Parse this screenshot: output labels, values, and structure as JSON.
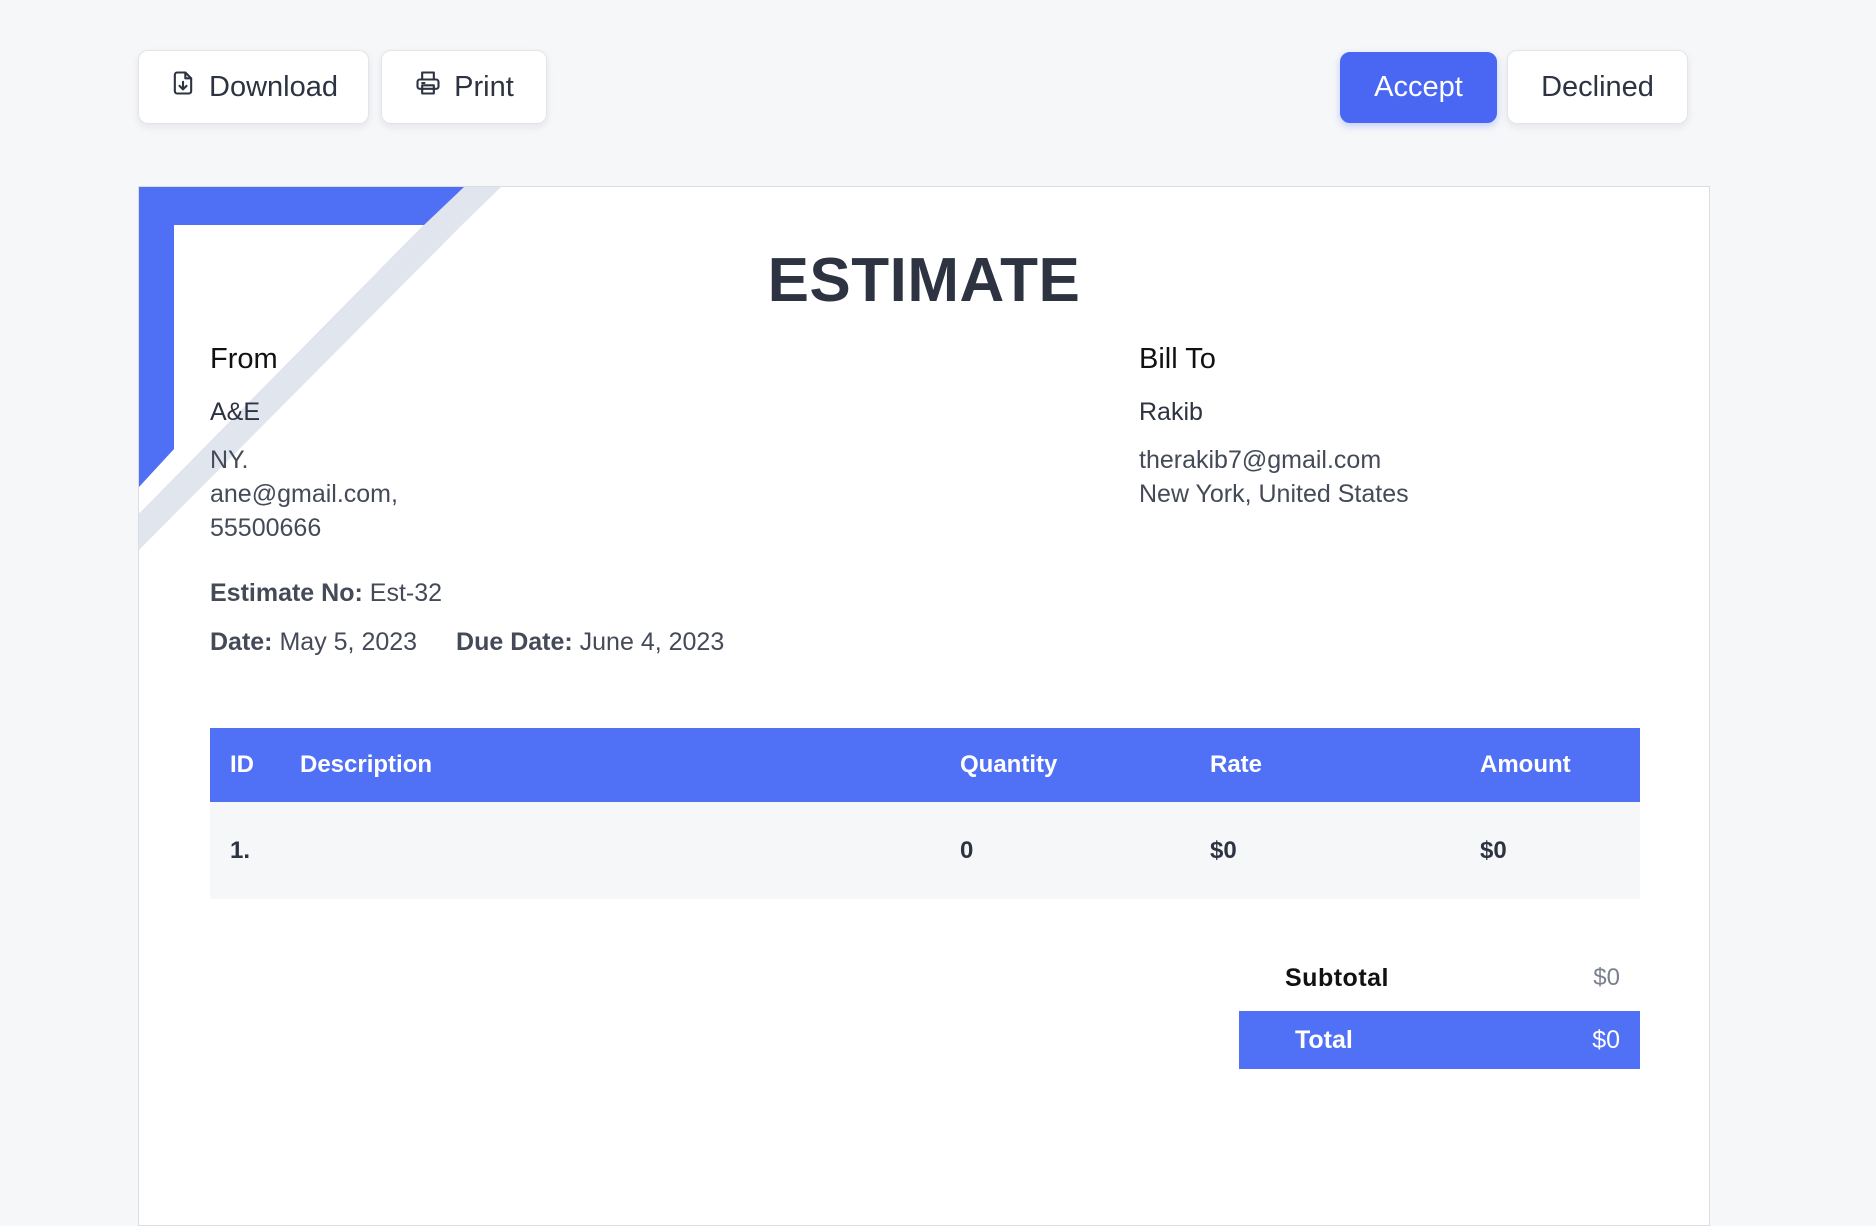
{
  "toolbar": {
    "download_label": "Download",
    "print_label": "Print",
    "accept_label": "Accept",
    "declined_label": "Declined"
  },
  "colors": {
    "accent": "#4a67f3",
    "table_header": "#5070f5",
    "corner_secondary": "#e1e5ee"
  },
  "estimate": {
    "title": "ESTIMATE",
    "from": {
      "heading": "From",
      "name": "A&E",
      "lines": [
        "NY.",
        "ane@gmail.com,",
        "55500666"
      ]
    },
    "bill_to": {
      "heading": "Bill To",
      "name": "Rakib",
      "lines": [
        "therakib7@gmail.com",
        "New York, United States"
      ]
    },
    "meta": {
      "number_label": "Estimate No:",
      "number": "Est-32",
      "date_label": "Date:",
      "date": "May 5, 2023",
      "due_label": "Due Date:",
      "due": "June 4, 2023"
    },
    "table": {
      "headers": [
        "ID",
        "Description",
        "Quantity",
        "Rate",
        "Amount"
      ],
      "rows": [
        [
          "1.",
          "",
          "0",
          "$0",
          "$0"
        ]
      ]
    },
    "totals": {
      "subtotal_label": "Subtotal",
      "subtotal": "$0",
      "total_label": "Total",
      "total": "$0"
    }
  }
}
